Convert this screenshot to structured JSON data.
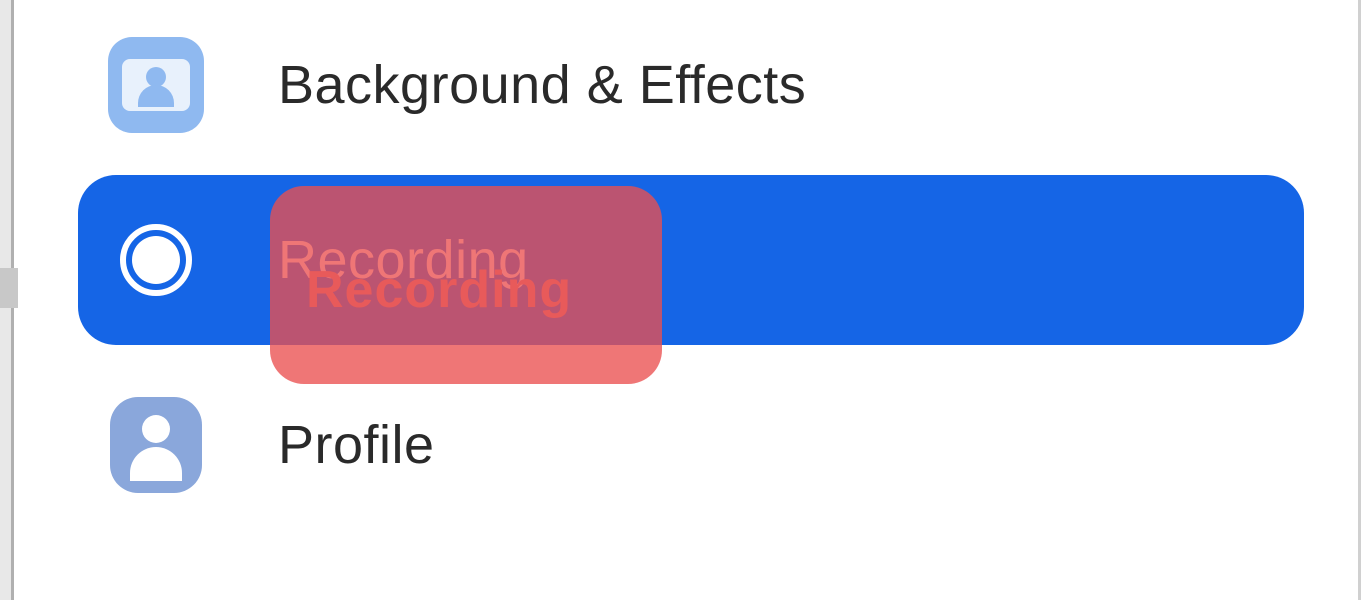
{
  "sidebar": {
    "items": [
      {
        "label": "Background & Effects",
        "active": false
      },
      {
        "label": "Recording",
        "active": true
      },
      {
        "label": "Profile",
        "active": false
      }
    ]
  },
  "highlight": {
    "label": "Recording"
  }
}
